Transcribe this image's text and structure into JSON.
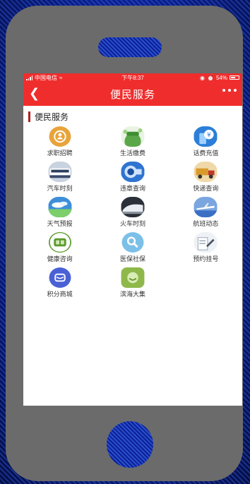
{
  "status": {
    "carrier": "中国电信",
    "time": "下午8:37",
    "battery": "54%"
  },
  "nav": {
    "title": "便民服务",
    "back_icon": "chevron-left-icon",
    "more_icon": "more-dots-icon"
  },
  "section": {
    "title": "便民服务"
  },
  "services": [
    {
      "label": "求职招聘",
      "icon": "job-person-icon",
      "color": "#e8a33a"
    },
    {
      "label": "生活缴费",
      "icon": "life-payment-icon",
      "color": "#5aa74a"
    },
    {
      "label": "话费充值",
      "icon": "phone-recharge-icon",
      "color": "#2c7fd8"
    },
    {
      "label": "汽车时刻",
      "icon": "bus-schedule-icon",
      "color": "#6e7f9a"
    },
    {
      "label": "违章查询",
      "icon": "traffic-camera-icon",
      "color": "#2f74d1"
    },
    {
      "label": "快递查询",
      "icon": "express-truck-icon",
      "color": "#d99a2c"
    },
    {
      "label": "天气预报",
      "icon": "weather-icon",
      "color": "#3d8fd8"
    },
    {
      "label": "火车时刻",
      "icon": "train-schedule-icon",
      "color": "#555f6e"
    },
    {
      "label": "航班动态",
      "icon": "flight-icon",
      "color": "#3a6fc4"
    },
    {
      "label": "健康咨询",
      "icon": "health-icon",
      "color": "#5a9a2a"
    },
    {
      "label": "医保社保",
      "icon": "search-icon",
      "color": "#7cc0e8"
    },
    {
      "label": "预约挂号",
      "icon": "appointment-icon",
      "color": "#9aa8b8"
    },
    {
      "label": "积分商城",
      "icon": "points-mall-icon",
      "color": "#4a61d6"
    },
    {
      "label": "滨海大集",
      "icon": "binhai-market-icon",
      "color": "#8fb84a"
    }
  ]
}
